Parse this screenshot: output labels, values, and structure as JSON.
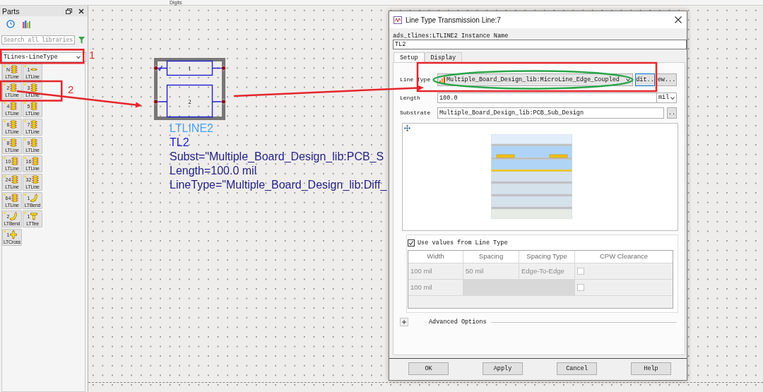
{
  "toolbar": {
    "label": "Digits"
  },
  "parts_panel": {
    "title": "Parts",
    "search": {
      "placeholder": "Search all libraries"
    },
    "library": "TLines-LineType",
    "palette": [
      {
        "number": "N",
        "label": "LTLine",
        "kind": "stack"
      },
      {
        "number": "1",
        "label": "LTLine",
        "kind": "single"
      },
      {
        "number": "2",
        "label": "LTLine",
        "kind": "stack"
      },
      {
        "number": "3",
        "label": "LTLine",
        "kind": "stack"
      },
      {
        "number": "4",
        "label": "LTLine",
        "kind": "stack"
      },
      {
        "number": "5",
        "label": "LTLine",
        "kind": "stack"
      },
      {
        "number": "6",
        "label": "LTLine",
        "kind": "stack"
      },
      {
        "number": "7",
        "label": "LTLine",
        "kind": "stack"
      },
      {
        "number": "8",
        "label": "LTLine",
        "kind": "stack"
      },
      {
        "number": "9",
        "label": "LTLine",
        "kind": "stack"
      },
      {
        "number": "10",
        "label": "LTLine",
        "kind": "stack"
      },
      {
        "number": "16",
        "label": "LTLine",
        "kind": "stack"
      },
      {
        "number": "24",
        "label": "LTLine",
        "kind": "stack"
      },
      {
        "number": "32",
        "label": "LTLine",
        "kind": "stack"
      },
      {
        "number": "64",
        "label": "LTLine",
        "kind": "stack"
      },
      {
        "number": "1",
        "label": "LTBend",
        "kind": "bend"
      },
      {
        "number": "2",
        "label": "LTBend",
        "kind": "bend"
      },
      {
        "number": "1",
        "label": "LTTee",
        "kind": "tee"
      },
      {
        "number": "1",
        "label": "LTCross",
        "kind": "cross"
      }
    ]
  },
  "callouts": [
    {
      "number": "1"
    },
    {
      "number": "2"
    }
  ],
  "schematic": {
    "component": {
      "pins": [
        "1",
        "2"
      ],
      "model": "LTLINE2",
      "instance": "TL2",
      "parameters": [
        "Subst=\"Multiple_Board_Design_lib:PCB_S",
        "Length=100.0 mil",
        "LineType=\"Multiple_Board_Design_lib:Diff_"
      ]
    }
  },
  "dialog": {
    "title": "Line Type Transmission Line:7",
    "instance_label": "ads_tlines:LTLINE2 Instance Name",
    "instance_value": "TL2",
    "tabs": [
      {
        "label": "Setup",
        "selected": true
      },
      {
        "label": "Display",
        "selected": false
      }
    ],
    "line_type": {
      "label": "Line Type",
      "value": "Multiple_Board_Design_lib:MicroLine_Edge_Coupled",
      "buttons": [
        {
          "label": "dit..",
          "focused": true
        },
        {
          "label": "ew...",
          "focused": false
        }
      ]
    },
    "length": {
      "label": "Length",
      "value": "100.0",
      "unit": "mil"
    },
    "substrate": {
      "label": "Substrate",
      "value": "Multiple_Board_Design_lib:PCB_Sub_Design",
      "button": ".."
    },
    "use_values": {
      "label": "Use values from Line Type",
      "checked": true
    },
    "table": {
      "columns": [
        "Width",
        "Spacing",
        "Spacing Type",
        "CPW Clearance"
      ],
      "rows": [
        {
          "width": "100 mil",
          "spacing": "50 mil",
          "spacing_type": "Edge-To-Edge",
          "cpw_clearance": false
        },
        {
          "width": "100 mil",
          "cpw_clearance": false
        }
      ]
    },
    "advanced": {
      "label": "Advanced Options",
      "expanded": false
    },
    "buttons": [
      "OK",
      "Apply",
      "Cancel",
      "Help"
    ]
  }
}
